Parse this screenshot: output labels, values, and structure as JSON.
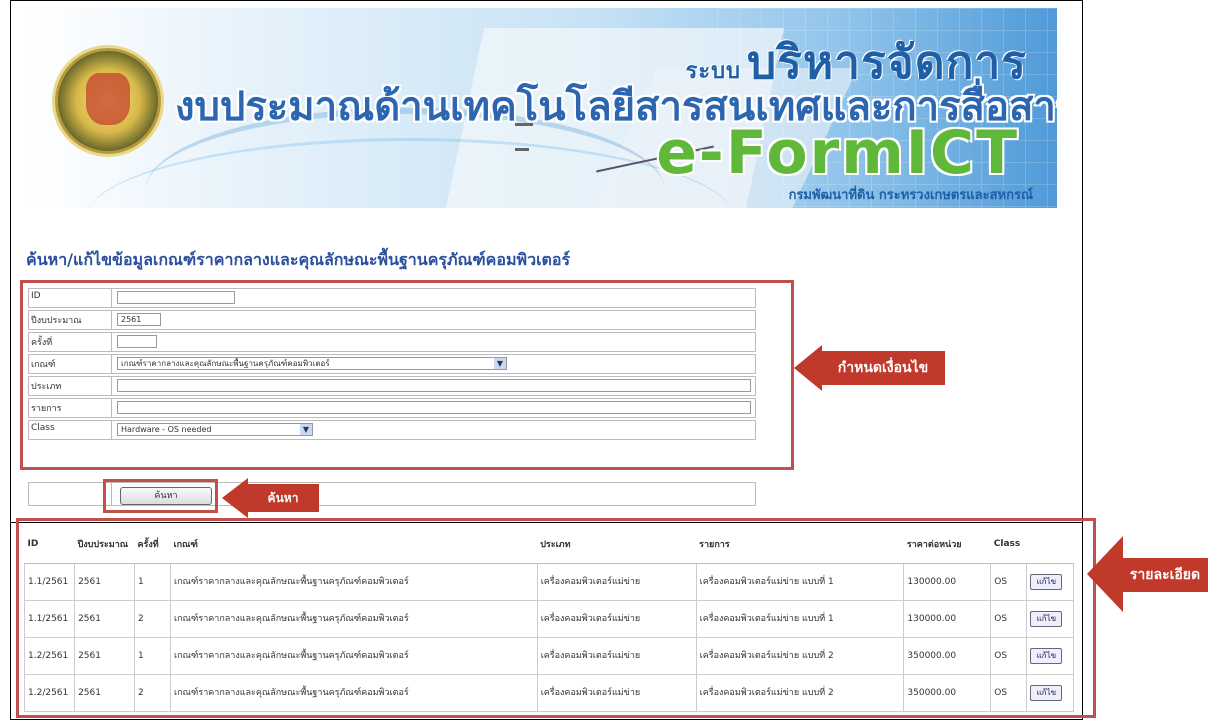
{
  "banner": {
    "system_prefix": "ระบบ",
    "title_line1": "บริหารจัดการ",
    "title_line2": "งบประมาณด้านเทคโนโลยีสารสนเทศและการสื่อสาร",
    "brand": "e-FormICT",
    "department": "กรมพัฒนาที่ดิน กระทรวงเกษตรและสหกรณ์"
  },
  "page_title": "ค้นหา/แก้ไขข้อมูลเกณฑ์ราคากลางและคุณลักษณะพื้นฐานครุภัณฑ์คอมพิวเตอร์",
  "form": {
    "fields": [
      {
        "label": "ID",
        "value": ""
      },
      {
        "label": "ปีงบประมาณ",
        "value": "2561"
      },
      {
        "label": "ครั้งที่",
        "value": ""
      },
      {
        "label": "เกณฑ์",
        "value": "เกณฑ์ราคากลางและคุณลักษณะพื้นฐานครุภัณฑ์คอมพิวเตอร์"
      },
      {
        "label": "ประเภท",
        "value": ""
      },
      {
        "label": "รายการ",
        "value": ""
      },
      {
        "label": "Class",
        "value": "Hardware - OS needed"
      }
    ],
    "search_button": "ค้นหา"
  },
  "callouts": {
    "condition": "กำหนดเงื่อนไข",
    "search": "ค้นหา",
    "details": "รายละเอียด"
  },
  "table": {
    "headers": [
      "ID",
      "ปีงบประมาณ",
      "ครั้งที่",
      "เกณฑ์",
      "ประเภท",
      "รายการ",
      "ราคาต่อหน่วย",
      "Class",
      ""
    ],
    "rows": [
      {
        "id": "1.1/2561",
        "year": "2561",
        "round": "1",
        "criteria": "เกณฑ์ราคากลางและคุณลักษณะพื้นฐานครุภัณฑ์คอมพิวเตอร์",
        "type": "เครื่องคอมพิวเตอร์แม่ข่าย",
        "item": "เครื่องคอมพิวเตอร์แม่ข่าย แบบที่ 1",
        "price": "130000.00",
        "class": "OS",
        "action": "แก้ไข"
      },
      {
        "id": "1.1/2561",
        "year": "2561",
        "round": "2",
        "criteria": "เกณฑ์ราคากลางและคุณลักษณะพื้นฐานครุภัณฑ์คอมพิวเตอร์",
        "type": "เครื่องคอมพิวเตอร์แม่ข่าย",
        "item": "เครื่องคอมพิวเตอร์แม่ข่าย แบบที่ 1",
        "price": "130000.00",
        "class": "OS",
        "action": "แก้ไข"
      },
      {
        "id": "1.2/2561",
        "year": "2561",
        "round": "1",
        "criteria": "เกณฑ์ราคากลางและคุณลักษณะพื้นฐานครุภัณฑ์คอมพิวเตอร์",
        "type": "เครื่องคอมพิวเตอร์แม่ข่าย",
        "item": "เครื่องคอมพิวเตอร์แม่ข่าย แบบที่ 2",
        "price": "350000.00",
        "class": "OS",
        "action": "แก้ไข"
      },
      {
        "id": "1.2/2561",
        "year": "2561",
        "round": "2",
        "criteria": "เกณฑ์ราคากลางและคุณลักษณะพื้นฐานครุภัณฑ์คอมพิวเตอร์",
        "type": "เครื่องคอมพิวเตอร์แม่ข่าย",
        "item": "เครื่องคอมพิวเตอร์แม่ข่าย แบบที่ 2",
        "price": "350000.00",
        "class": "OS",
        "action": "แก้ไข"
      }
    ]
  },
  "colors": {
    "annotation": "#c0504d",
    "callout": "#c0392b",
    "title": "#2b4f9e",
    "brand": "#5fb83a"
  }
}
